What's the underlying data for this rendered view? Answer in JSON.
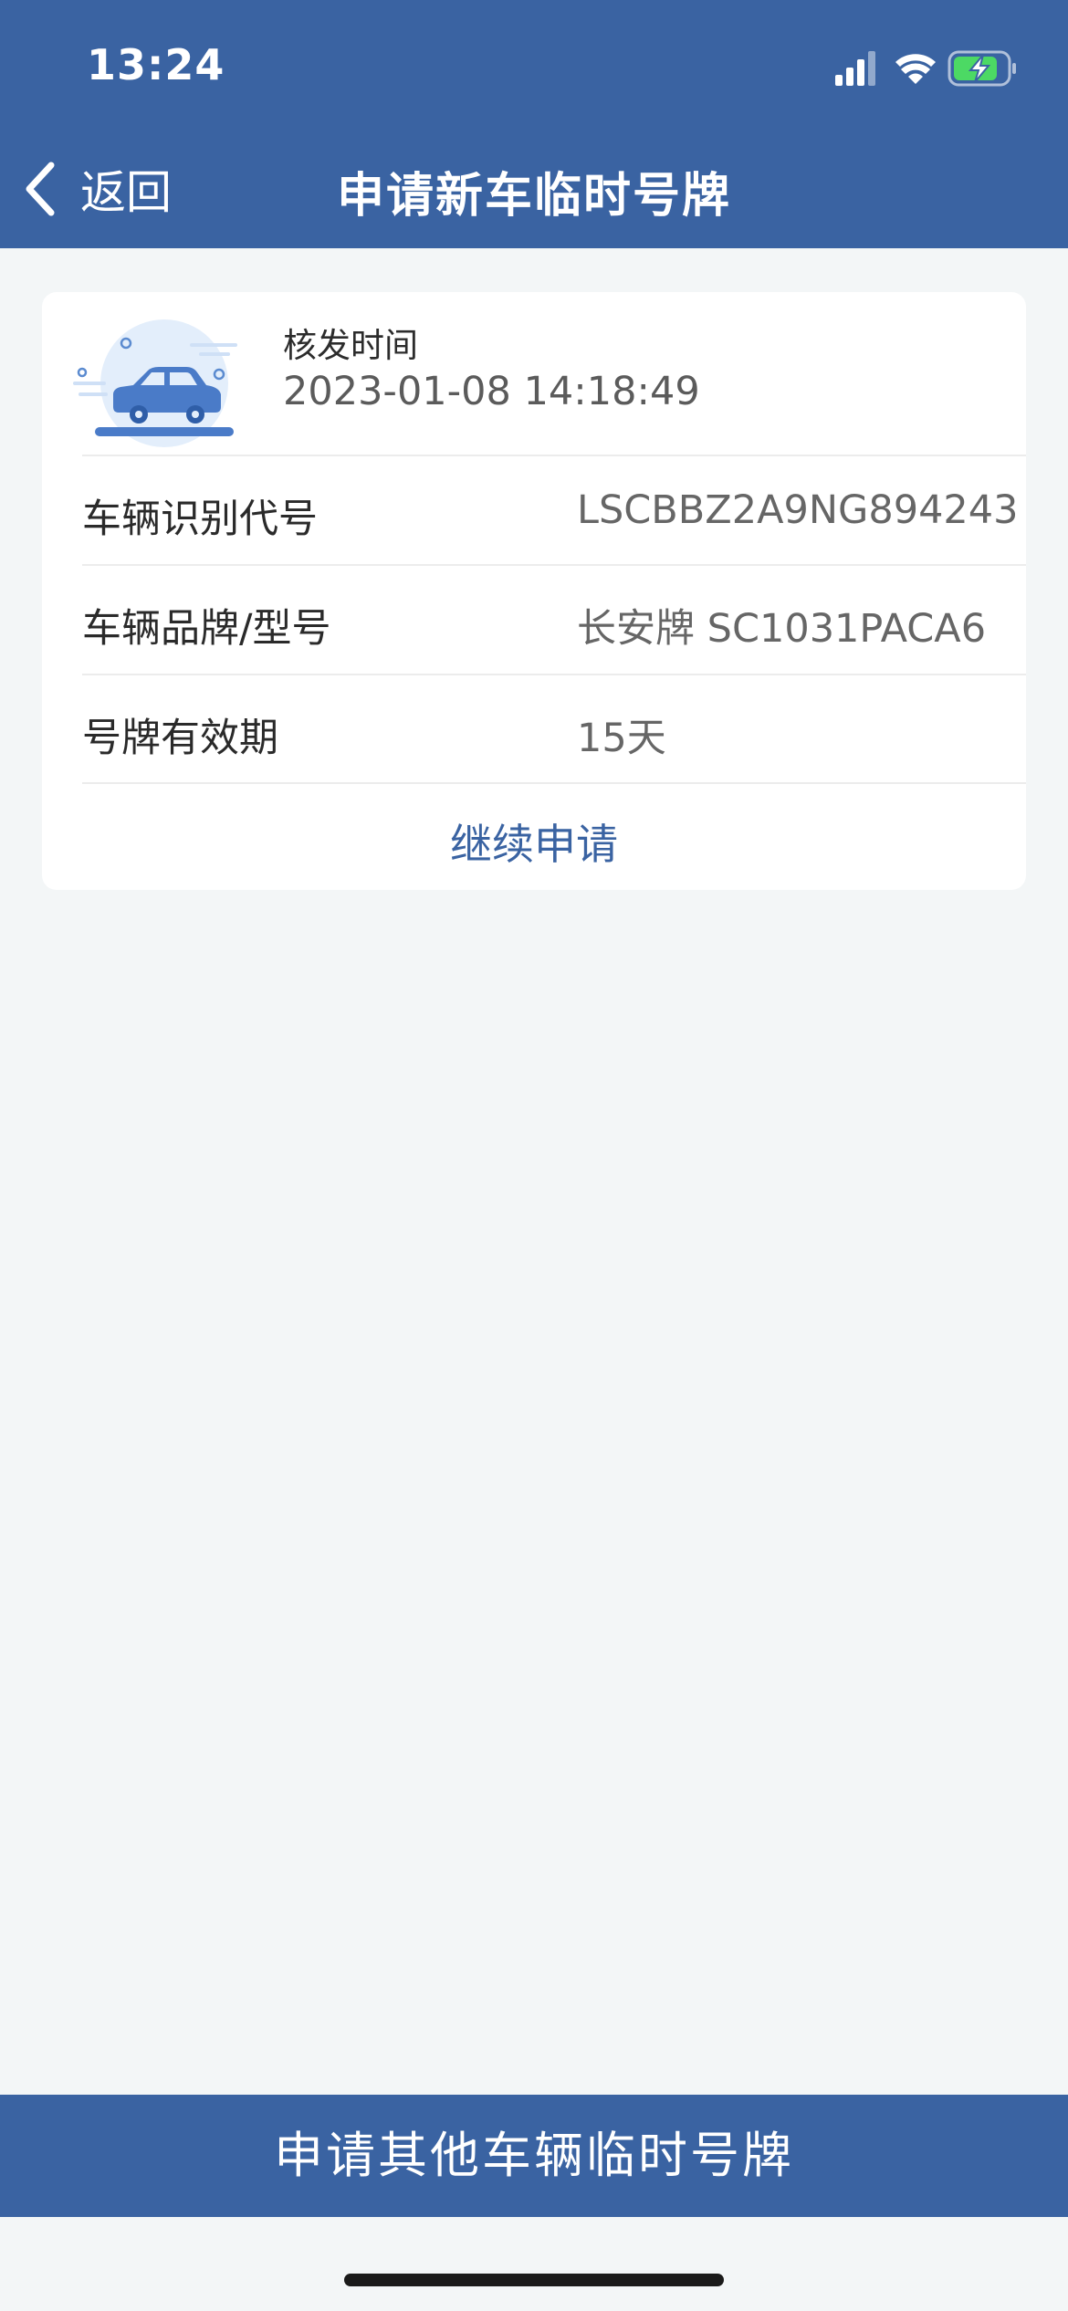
{
  "status_bar": {
    "time": "13:24"
  },
  "nav": {
    "back_label": "返回",
    "title": "申请新车临时号牌"
  },
  "card": {
    "issue_label": "核发时间",
    "issue_time": "2023-01-08 14:18:49",
    "rows": [
      {
        "label": "车辆识别代号",
        "value": "LSCBBZ2A9NG894243"
      },
      {
        "label": "车辆品牌/型号",
        "value": "长安牌 SC1031PACA6"
      },
      {
        "label": "号牌有效期",
        "value": "15天"
      }
    ],
    "continue_label": "继续申请"
  },
  "footer": {
    "button_label": "申请其他车辆临时号牌"
  },
  "colors": {
    "brand": "#3a63a2",
    "background": "#f3f6f7",
    "battery": "#4cd964"
  },
  "icons": {
    "signal": "signal-icon",
    "wifi": "wifi-icon",
    "battery": "battery-charging-icon",
    "back": "chevron-left-icon",
    "car": "car-icon"
  }
}
